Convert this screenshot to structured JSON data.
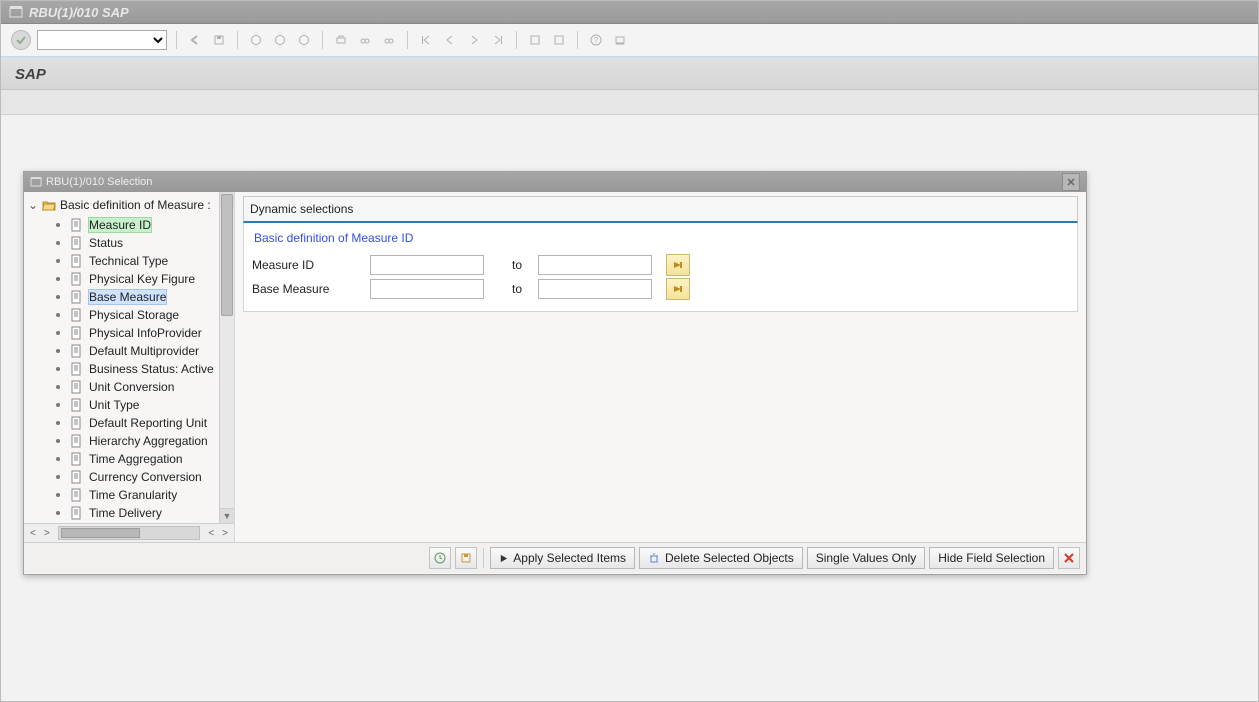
{
  "window_title": "RBU(1)/010 SAP",
  "app_title": "SAP",
  "modal": {
    "title": "RBU(1)/010 Selection",
    "tree_root": "Basic definition of Measure :",
    "tree_items": [
      "Measure ID",
      "Status",
      "Technical Type",
      "Physical Key Figure",
      "Base Measure",
      "Physical Storage",
      "Physical InfoProvider",
      "Default Multiprovider",
      "Business Status: Active",
      "Unit Conversion",
      "Unit Type",
      "Default Reporting Unit",
      "Hierarchy Aggregation",
      "Time Aggregation",
      "Currency Conversion",
      "Time Granularity",
      "Time Delivery"
    ],
    "selected_green_index": 0,
    "selected_blue_index": 4,
    "panel_title": "Dynamic selections",
    "section_label": "Basic definition of Measure ID",
    "rows": [
      {
        "label": "Measure ID",
        "to": "to"
      },
      {
        "label": "Base Measure",
        "to": "to"
      }
    ],
    "footer": {
      "apply": "Apply Selected Items",
      "delete": "Delete Selected Objects",
      "single": "Single Values Only",
      "hide": "Hide Field Selection"
    }
  }
}
